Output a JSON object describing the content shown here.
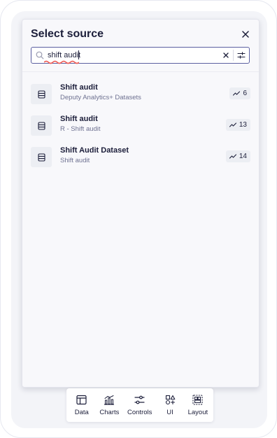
{
  "panel": {
    "title": "Select source"
  },
  "search": {
    "value": "shift audit",
    "placeholder": ""
  },
  "results": [
    {
      "title": "Shift audit",
      "subtitle": "Deputy Analytics+ Datasets",
      "count": "6"
    },
    {
      "title": "Shift audit",
      "subtitle": "R - Shift audit",
      "count": "13"
    },
    {
      "title": "Shift Audit Dataset",
      "subtitle": "Shift audit",
      "count": "14"
    }
  ],
  "toolbar": {
    "items": [
      {
        "label": "Data",
        "icon": "table-icon"
      },
      {
        "label": "Charts",
        "icon": "charts-icon"
      },
      {
        "label": "Controls",
        "icon": "sliders-icon"
      },
      {
        "label": "UI",
        "icon": "shapes-icon"
      },
      {
        "label": "Layout",
        "icon": "layout-icon"
      }
    ]
  },
  "colors": {
    "accent": "#5b5fa0",
    "text": "#1c1e3a",
    "muted": "#6e7191",
    "spellcheck": "#f0605a"
  }
}
